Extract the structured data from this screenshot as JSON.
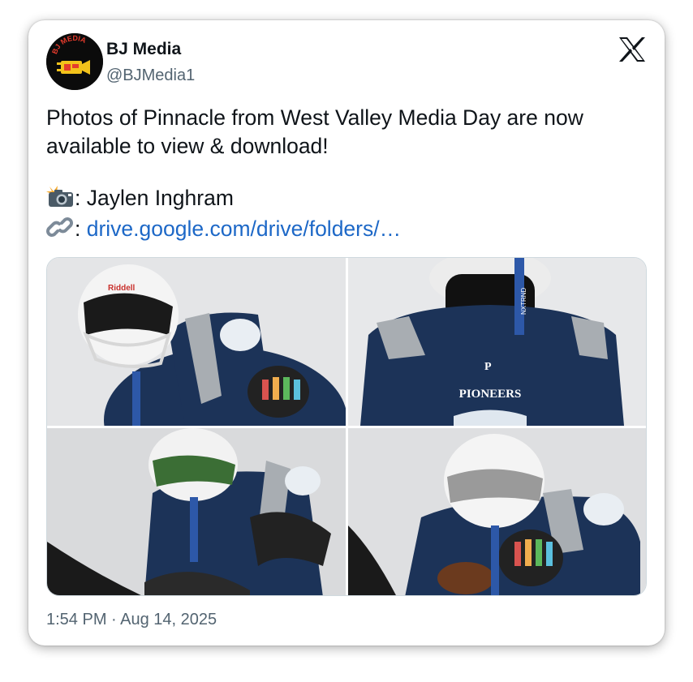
{
  "author": {
    "display_name": "BJ Media",
    "handle": "@BJMedia1",
    "avatar_text": "BJ MEDIA"
  },
  "platform_icon": "x-logo-icon",
  "tweet": {
    "line1": "Photos of Pinnacle from West Valley Media Day are now",
    "line2": "available to view & download!",
    "photographer_prefix": ": Jaylen Inghram",
    "link_prefix": ": ",
    "link_text": "drive.google.com/drive/folders/…",
    "camera_icon": "camera-flash-icon",
    "link_icon": "link-icon"
  },
  "media": {
    "count": 4,
    "jersey_text": "PIONEERS",
    "helmet_brand": "Riddell",
    "chinstrap_brand": "NXTRND"
  },
  "timestamp": "1:54 PM · Aug 14, 2025",
  "colors": {
    "jersey_navy": "#1c3358",
    "stripe_gray": "#a8adb2",
    "link_blue": "#1d68c7",
    "secondary_text": "#536471"
  }
}
